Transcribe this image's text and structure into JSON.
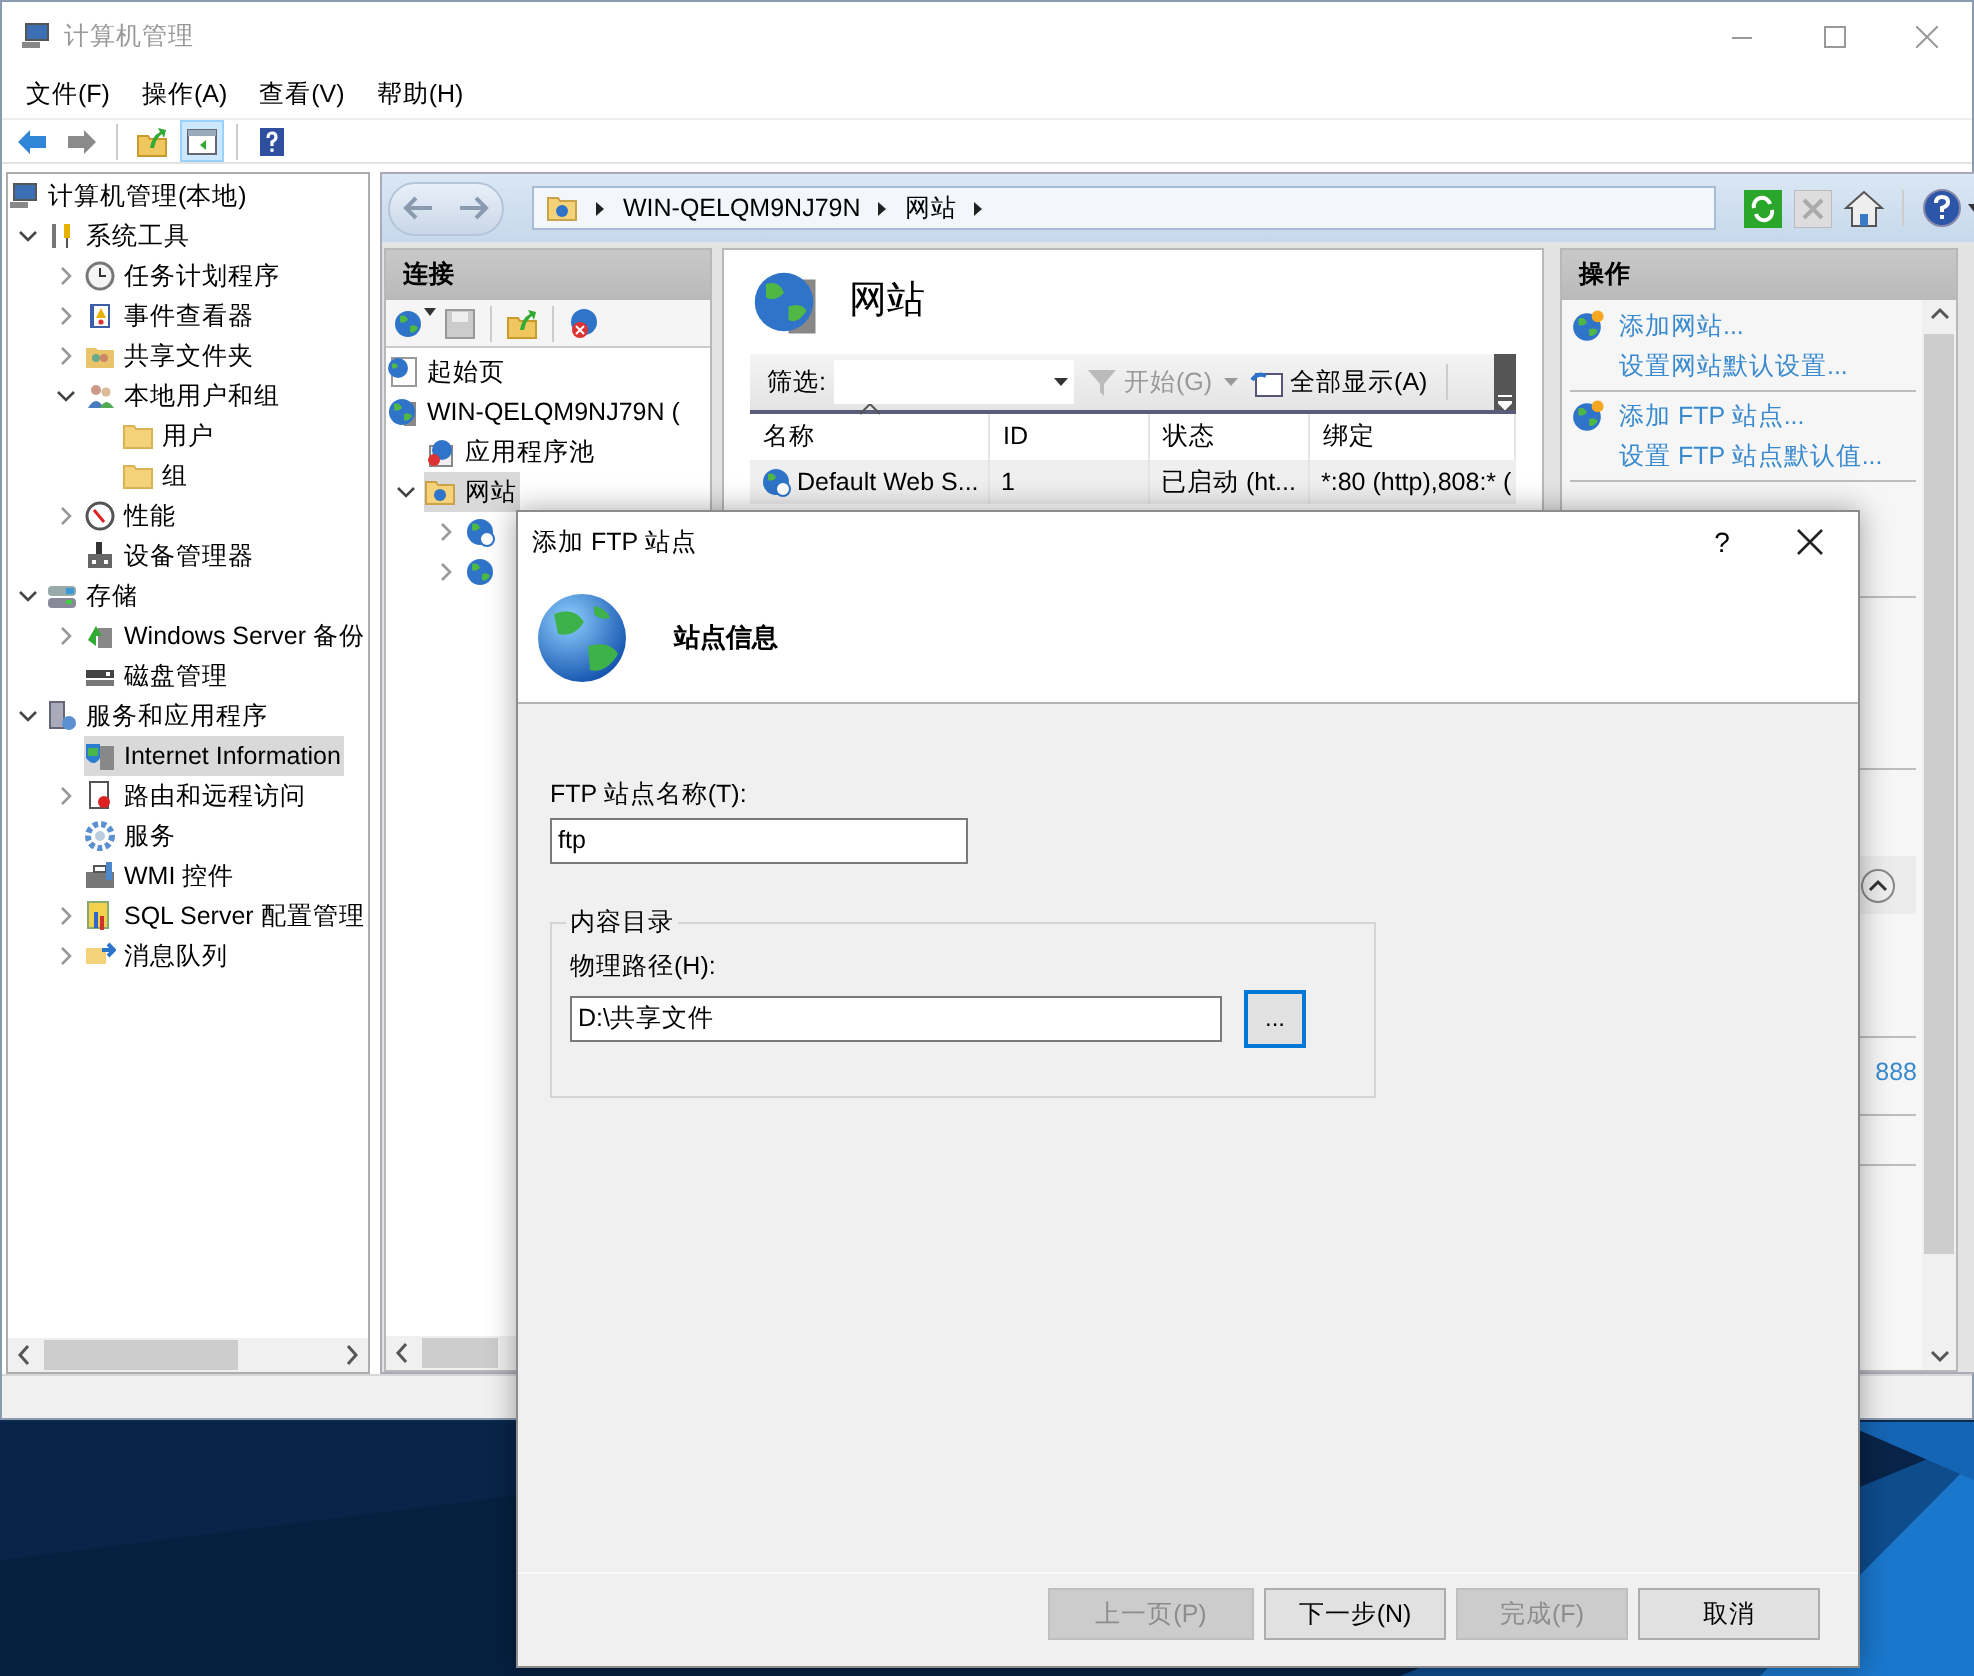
{
  "window": {
    "title": "计算机管理"
  },
  "menu": [
    "文件(F)",
    "操作(A)",
    "查看(V)",
    "帮助(H)"
  ],
  "toolbar": [
    {
      "kind": "back",
      "pressed": false
    },
    {
      "kind": "forward",
      "pressed": false
    },
    {
      "kind": "sep"
    },
    {
      "kind": "up",
      "pressed": false
    },
    {
      "kind": "tree",
      "pressed": true
    },
    {
      "kind": "sep"
    },
    {
      "kind": "help",
      "pressed": false
    }
  ],
  "tree": [
    {
      "label": "计算机管理(本地)",
      "kind": "computer",
      "selected": false,
      "children": [
        {
          "label": "系统工具",
          "kind": "tools",
          "expanded": true,
          "selected": false,
          "children": [
            {
              "label": "任务计划程序",
              "kind": "clock",
              "expanded": false,
              "selected": false
            },
            {
              "label": "事件查看器",
              "kind": "log",
              "expanded": false,
              "selected": false
            },
            {
              "label": "共享文件夹",
              "kind": "share",
              "expanded": false,
              "selected": false
            },
            {
              "label": "本地用户和组",
              "kind": "users",
              "expanded": true,
              "selected": false,
              "children": [
                {
                  "label": "用户",
                  "kind": "folder",
                  "selected": false
                },
                {
                  "label": "组",
                  "kind": "folder",
                  "selected": false
                }
              ]
            },
            {
              "label": "性能",
              "kind": "gauge",
              "expanded": false,
              "selected": false
            },
            {
              "label": "设备管理器",
              "kind": "device",
              "selected": false
            }
          ]
        },
        {
          "label": "存储",
          "kind": "storage",
          "expanded": true,
          "selected": false,
          "children": [
            {
              "label": "Windows Server 备份",
              "kind": "backup",
              "expanded": false,
              "selected": false
            },
            {
              "label": "磁盘管理",
              "kind": "disk",
              "selected": false
            }
          ]
        },
        {
          "label": "服务和应用程序",
          "kind": "services",
          "expanded": true,
          "selected": false,
          "children": [
            {
              "label": "Internet Information",
              "kind": "iis",
              "selected": true
            },
            {
              "label": "路由和远程访问",
              "kind": "routing",
              "expanded": false,
              "selected": false
            },
            {
              "label": "服务",
              "kind": "gear",
              "selected": false
            },
            {
              "label": "WMI 控件",
              "kind": "wmi",
              "selected": false
            },
            {
              "label": "SQL Server 配置管理",
              "kind": "sql",
              "expanded": false,
              "selected": false
            },
            {
              "label": "消息队列",
              "kind": "queue",
              "expanded": false,
              "selected": false
            }
          ]
        }
      ]
    }
  ],
  "iis": {
    "breadcrumb": [
      "WIN-QELQM9NJ79N",
      "网站"
    ],
    "connections": {
      "title": "连接",
      "tree": [
        {
          "label": "起始页",
          "kind": "start",
          "selected": false
        },
        {
          "label": "WIN-QELQM9NJ79N (",
          "kind": "server",
          "selected": false,
          "children": [
            {
              "label": "应用程序池",
              "kind": "apppool",
              "selected": false
            },
            {
              "label": "网站",
              "kind": "sitefolder",
              "expanded": true,
              "selected": true,
              "children": [
                {
                  "kind": "site",
                  "expanded": false,
                  "selected": false
                },
                {
                  "kind": "globe",
                  "expanded": false,
                  "selected": false
                }
              ]
            }
          ]
        }
      ]
    },
    "content": {
      "title": "网站",
      "filter_label": "筛选:",
      "start": {
        "label": "开始(G)",
        "disabled": true
      },
      "show_all": "全部显示(A)",
      "columns": [
        "名称",
        "ID",
        "状态",
        "绑定"
      ],
      "rows": [
        [
          "Default Web S...",
          "1",
          "已启动 (ht...",
          "*:80 (http),808:* ("
        ]
      ]
    },
    "actions": {
      "title": "操作",
      "groups": [
        {
          "items": [
            {
              "text": "添加网站...",
              "kind": "add"
            },
            {
              "text": "设置网站默认设置...",
              "kind": "plain"
            }
          ]
        },
        {
          "items": [
            {
              "text": "添加 FTP 站点...",
              "kind": "add"
            },
            {
              "text": "设置 FTP 站点默认值...",
              "kind": "plain"
            }
          ]
        }
      ],
      "fragment": "888"
    }
  },
  "dialog": {
    "title": "添加 FTP 站点",
    "help": "?",
    "heading": "站点信息",
    "name_label": "FTP 站点名称(T):",
    "name_value": "ftp",
    "group": "内容目录",
    "path_label": "物理路径(H):",
    "path_value": "D:\\共享文件",
    "browse": {
      "label": "...",
      "focused": true
    },
    "buttons": [
      {
        "label": "上一页(P)",
        "disabled": true
      },
      {
        "label": "下一步(N)",
        "disabled": false
      },
      {
        "label": "完成(F)",
        "disabled": true
      },
      {
        "label": "取消",
        "disabled": false
      }
    ]
  }
}
